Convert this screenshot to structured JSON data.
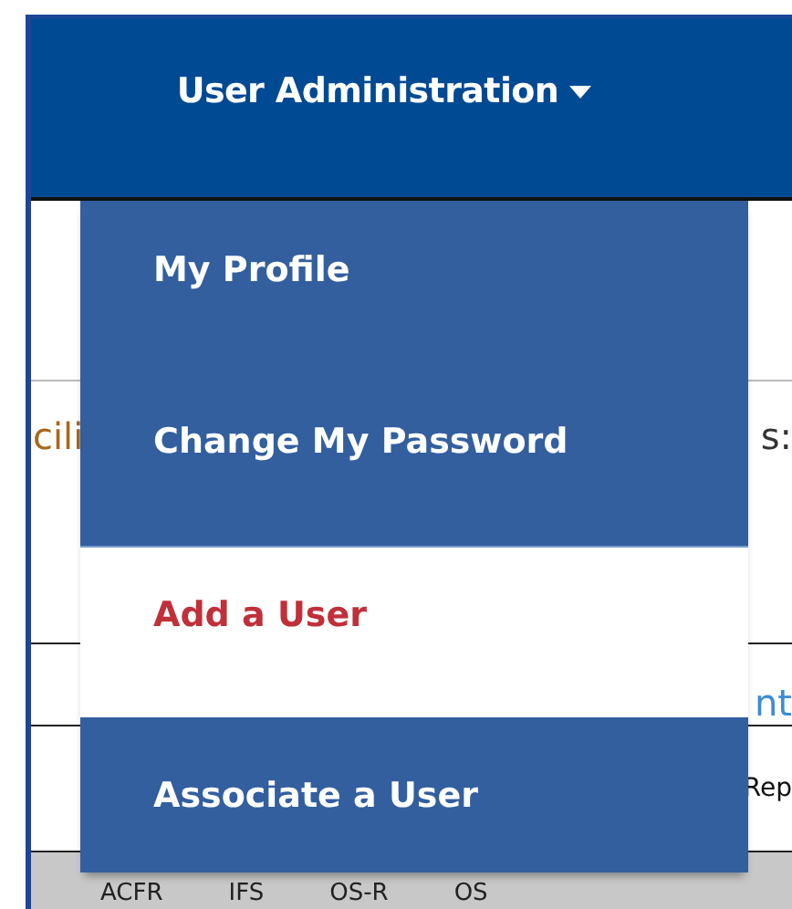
{
  "nav": {
    "menu_label": "User Administration",
    "expanded": true
  },
  "background": {
    "label_left": "cili",
    "label_right": "s:",
    "link": "nt",
    "row_text": "Rep",
    "header_cells": [
      "ACFR",
      "IFS",
      "OS-R",
      "OS"
    ]
  },
  "dropdown": {
    "items": [
      {
        "label": "My Profile",
        "selected": false
      },
      {
        "label": "Change My Password",
        "selected": false
      },
      {
        "label": "Add a User",
        "selected": true
      },
      {
        "label": "Associate a User",
        "selected": false
      }
    ]
  }
}
